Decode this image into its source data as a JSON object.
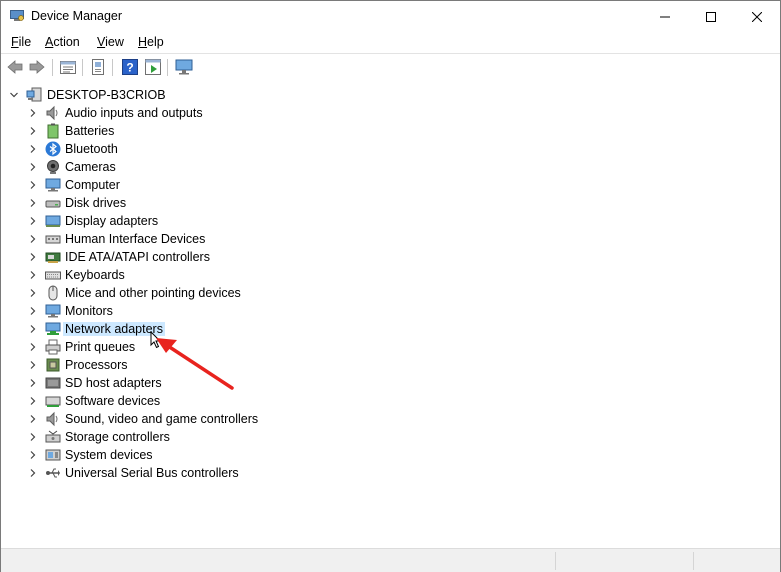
{
  "window": {
    "title": "Device Manager",
    "minimize": "—",
    "maximize": "☐",
    "close": "✕"
  },
  "menu": [
    {
      "label": "File",
      "key": "F",
      "rest": "ile"
    },
    {
      "label": "Action",
      "key": "A",
      "rest": "ction"
    },
    {
      "label": "View",
      "key": "V",
      "rest": "iew"
    },
    {
      "label": "Help",
      "key": "H",
      "rest": "elp"
    }
  ],
  "toolbar": [
    "back-icon",
    "forward-icon",
    "properties-icon",
    "update-icon",
    "help-icon",
    "scan-icon",
    "monitor-icon"
  ],
  "tree": {
    "root": "DESKTOP-B3CRIOB",
    "items": [
      {
        "label": "Audio inputs and outputs",
        "icon": "speaker-icon"
      },
      {
        "label": "Batteries",
        "icon": "battery-icon"
      },
      {
        "label": "Bluetooth",
        "icon": "bluetooth-icon"
      },
      {
        "label": "Cameras",
        "icon": "camera-icon"
      },
      {
        "label": "Computer",
        "icon": "computer-icon"
      },
      {
        "label": "Disk drives",
        "icon": "disk-icon"
      },
      {
        "label": "Display adapters",
        "icon": "display-adapter-icon"
      },
      {
        "label": "Human Interface Devices",
        "icon": "hid-icon"
      },
      {
        "label": "IDE ATA/ATAPI controllers",
        "icon": "ide-icon"
      },
      {
        "label": "Keyboards",
        "icon": "keyboard-icon"
      },
      {
        "label": "Mice and other pointing devices",
        "icon": "mouse-icon"
      },
      {
        "label": "Monitors",
        "icon": "monitor-icon"
      },
      {
        "label": "Network adapters",
        "icon": "network-icon",
        "selected": true
      },
      {
        "label": "Print queues",
        "icon": "printer-icon"
      },
      {
        "label": "Processors",
        "icon": "processor-icon"
      },
      {
        "label": "SD host adapters",
        "icon": "sd-icon"
      },
      {
        "label": "Software devices",
        "icon": "software-icon"
      },
      {
        "label": "Sound, video and game controllers",
        "icon": "sound-icon"
      },
      {
        "label": "Storage controllers",
        "icon": "storage-icon"
      },
      {
        "label": "System devices",
        "icon": "system-icon"
      },
      {
        "label": "Universal Serial Bus controllers",
        "icon": "usb-icon"
      }
    ]
  },
  "colors": {
    "selection": "#cce8ff",
    "annotation_arrow": "#e8231e"
  }
}
